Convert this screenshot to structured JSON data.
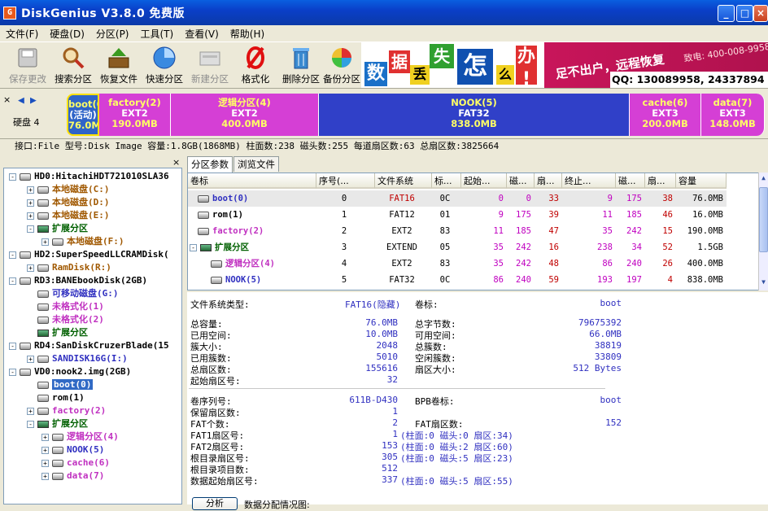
{
  "window": {
    "title": "DiskGenius V3.8.0 免费版"
  },
  "menu": [
    "文件(F)",
    "硬盘(D)",
    "分区(P)",
    "工具(T)",
    "查看(V)",
    "帮助(H)"
  ],
  "toolbar": [
    {
      "label": "保存更改",
      "icon": "save-icon",
      "disabled": true
    },
    {
      "label": "搜索分区",
      "icon": "magnifier-icon",
      "disabled": false
    },
    {
      "label": "恢复文件",
      "icon": "restore-icon",
      "disabled": false
    },
    {
      "label": "快速分区",
      "icon": "quick-partition-icon",
      "disabled": false
    },
    {
      "label": "新建分区",
      "icon": "new-partition-icon",
      "disabled": true
    },
    {
      "label": "格式化",
      "icon": "format-icon",
      "disabled": false
    },
    {
      "label": "删除分区",
      "icon": "trash-icon",
      "disabled": false
    },
    {
      "label": "备份分区",
      "icon": "backup-icon",
      "disabled": false
    }
  ],
  "banner": {
    "chars": [
      "数",
      "据",
      "丢",
      "失",
      "怎",
      "么",
      "办",
      "!"
    ],
    "slogan": "足不出户，远程恢复",
    "phone": "致电: 400-008-9958",
    "qq": "QQ: 130089958, 24337894"
  },
  "disk_label": "硬盘 4",
  "partitions": [
    {
      "name": "boot(0)",
      "fs": "(活动)",
      "size": "76.0MB",
      "color": "#2f64c8"
    },
    {
      "name": "factory(2)",
      "fs": "EXT2",
      "size": "190.0MB",
      "color": "#d53fd5"
    },
    {
      "name": "逻辑分区(4)",
      "fs": "EXT2",
      "size": "400.0MB",
      "color": "#d53fd5"
    },
    {
      "name": "NOOK(5)",
      "fs": "FAT32",
      "size": "838.0MB",
      "color": "#3040c8"
    },
    {
      "name": "cache(6)",
      "fs": "EXT3",
      "size": "200.0MB",
      "color": "#d53fd5"
    },
    {
      "name": "data(7)",
      "fs": "EXT3",
      "size": "148.0MB",
      "color": "#d53fd5"
    }
  ],
  "infoline": "接口:File  型号:Disk Image  容量:1.8GB(1868MB)  柱面数:238  磁头数:255  每道扇区数:63  总扇区数:3825664",
  "tree": [
    {
      "label": "HD0:HitachiHDT721010SLA36",
      "level": 0,
      "exp": "-",
      "color": "#000"
    },
    {
      "label": "本地磁盘(C:)",
      "level": 1,
      "exp": "+",
      "color": "#a05800"
    },
    {
      "label": "本地磁盘(D:)",
      "level": 1,
      "exp": "+",
      "color": "#a05800"
    },
    {
      "label": "本地磁盘(E:)",
      "level": 1,
      "exp": "+",
      "color": "#a05800"
    },
    {
      "label": "扩展分区",
      "level": 1,
      "exp": "-",
      "color": "#006000"
    },
    {
      "label": "本地磁盘(F:)",
      "level": 2,
      "exp": "+",
      "color": "#a05800"
    },
    {
      "label": "HD2:SuperSpeedLLCRAMDisk(",
      "level": 0,
      "exp": "-",
      "color": "#000"
    },
    {
      "label": "RamDisk(R:)",
      "level": 1,
      "exp": "+",
      "color": "#a05800"
    },
    {
      "label": "RD3:BANEbookDisk(2GB)",
      "level": 0,
      "exp": "-",
      "color": "#000"
    },
    {
      "label": "可移动磁盘(G:)",
      "level": 1,
      "exp": "",
      "color": "#3030c0"
    },
    {
      "label": "未格式化(1)",
      "level": 1,
      "exp": "",
      "color": "#c030c0"
    },
    {
      "label": "未格式化(2)",
      "level": 1,
      "exp": "",
      "color": "#c030c0"
    },
    {
      "label": "扩展分区",
      "level": 1,
      "exp": "",
      "color": "#006000"
    },
    {
      "label": "RD4:SanDiskCruzerBlade(15",
      "level": 0,
      "exp": "-",
      "color": "#000"
    },
    {
      "label": "SANDISK16G(I:)",
      "level": 1,
      "exp": "+",
      "color": "#3030c0"
    },
    {
      "label": "VD0:nook2.img(2GB)",
      "level": 0,
      "exp": "-",
      "color": "#000"
    },
    {
      "label": "boot(0)",
      "level": 1,
      "exp": "",
      "color": "#fff",
      "selected": true
    },
    {
      "label": "rom(1)",
      "level": 1,
      "exp": "",
      "color": "#000"
    },
    {
      "label": "factory(2)",
      "level": 1,
      "exp": "+",
      "color": "#c030c0"
    },
    {
      "label": "扩展分区",
      "level": 1,
      "exp": "-",
      "color": "#006000"
    },
    {
      "label": "逻辑分区(4)",
      "level": 2,
      "exp": "+",
      "color": "#c030c0"
    },
    {
      "label": "NOOK(5)",
      "level": 2,
      "exp": "+",
      "color": "#3030c0"
    },
    {
      "label": "cache(6)",
      "level": 2,
      "exp": "+",
      "color": "#c030c0"
    },
    {
      "label": "data(7)",
      "level": 2,
      "exp": "+",
      "color": "#c030c0"
    }
  ],
  "tabs": [
    "分区参数",
    "浏览文件"
  ],
  "columns": [
    "卷标",
    "序号(...",
    "文件系统",
    "标...",
    "起始...",
    "磁...",
    "扇...",
    "终止...",
    "磁...",
    "扇...",
    "容量"
  ],
  "rows": [
    {
      "cells": [
        "boot(0)",
        "0",
        "FAT16",
        "0C",
        "0",
        "0",
        "33",
        "9",
        "175",
        "38",
        "76.0MB"
      ],
      "color": "#3030c0",
      "fscolor": "#c00000",
      "indent": 0,
      "selected": true
    },
    {
      "cells": [
        "rom(1)",
        "1",
        "FAT12",
        "01",
        "9",
        "175",
        "39",
        "11",
        "185",
        "46",
        "16.0MB"
      ],
      "color": "#000",
      "fscolor": "#000",
      "indent": 0
    },
    {
      "cells": [
        "factory(2)",
        "2",
        "EXT2",
        "83",
        "11",
        "185",
        "47",
        "35",
        "242",
        "15",
        "190.0MB"
      ],
      "color": "#c030c0",
      "fscolor": "#000",
      "indent": 0
    },
    {
      "cells": [
        "扩展分区",
        "3",
        "EXTEND",
        "05",
        "35",
        "242",
        "16",
        "238",
        "34",
        "52",
        "1.5GB"
      ],
      "color": "#006000",
      "fscolor": "#000",
      "indent": -1
    },
    {
      "cells": [
        "逻辑分区(4)",
        "4",
        "EXT2",
        "83",
        "35",
        "242",
        "48",
        "86",
        "240",
        "26",
        "400.0MB"
      ],
      "color": "#c030c0",
      "fscolor": "#000",
      "indent": 1
    },
    {
      "cells": [
        "NOOK(5)",
        "5",
        "FAT32",
        "0C",
        "86",
        "240",
        "59",
        "193",
        "197",
        "4",
        "838.0MB"
      ],
      "color": "#3030c0",
      "fscolor": "#000",
      "indent": 1
    }
  ],
  "detail": {
    "fs_type_label": "文件系统类型:",
    "fs_type_value": "FAT16(隐藏)",
    "vol_label": "卷标:",
    "vol_value": "boot",
    "block1": [
      [
        "总容量:",
        "76.0MB",
        "总字节数:",
        "79675392"
      ],
      [
        "已用空间:",
        "10.0MB",
        "可用空间:",
        "66.0MB"
      ],
      [
        "簇大小:",
        "2048",
        "总簇数:",
        "38819"
      ],
      [
        "已用簇数:",
        "5010",
        "空闲簇数:",
        "33809"
      ],
      [
        "总扇区数:",
        "155616",
        "扇区大小:",
        "512 Bytes"
      ],
      [
        "起始扇区号:",
        "32",
        "",
        ""
      ]
    ],
    "block2": [
      [
        "卷序列号:",
        "611B-D430",
        "BPB卷标:",
        "boot"
      ],
      [
        "保留扇区数:",
        "1",
        "",
        ""
      ],
      [
        "FAT个数:",
        "2",
        "FAT扇区数:",
        "152"
      ],
      [
        "FAT1扇区号:",
        "1",
        "(柱面:0 磁头:0 扇区:34)",
        ""
      ],
      [
        "FAT2扇区号:",
        "153",
        "(柱面:0 磁头:2 扇区:60)",
        ""
      ],
      [
        "根目录扇区号:",
        "305",
        "(柱面:0 磁头:5 扇区:23)",
        ""
      ],
      [
        "根目录项目数:",
        "512",
        "",
        ""
      ],
      [
        "数据起始扇区号:",
        "337",
        "(柱面:0 磁头:5 扇区:55)",
        ""
      ]
    ],
    "analyze_button": "分析",
    "alloc_label": "数据分配情况图:"
  }
}
